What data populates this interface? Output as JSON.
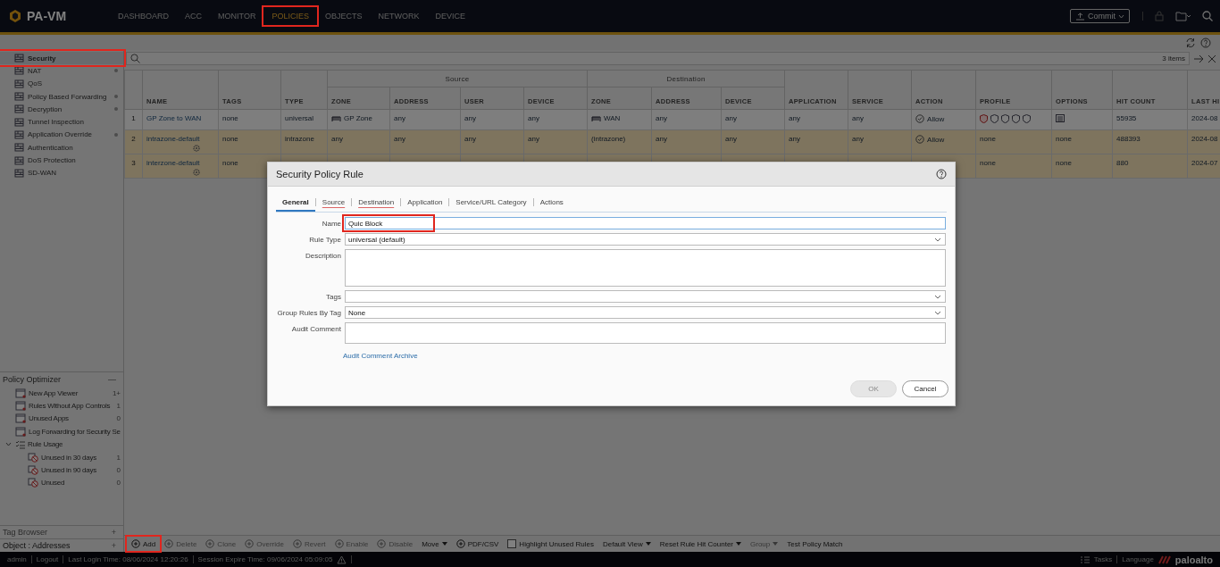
{
  "header": {
    "logo": "PA-VM",
    "nav": [
      {
        "label": "DASHBOARD",
        "selected": false,
        "highlighted": false
      },
      {
        "label": "ACC",
        "selected": false,
        "highlighted": false
      },
      {
        "label": "MONITOR",
        "selected": false,
        "highlighted": false
      },
      {
        "label": "POLICIES",
        "selected": true,
        "highlighted": true
      },
      {
        "label": "OBJECTS",
        "selected": false,
        "highlighted": false
      },
      {
        "label": "NETWORK",
        "selected": false,
        "highlighted": false
      },
      {
        "label": "DEVICE",
        "selected": false,
        "highlighted": false
      }
    ],
    "commit": "Commit"
  },
  "sidebar": {
    "items": [
      {
        "label": "Security",
        "selected": true,
        "highlighted": true,
        "dot": false
      },
      {
        "label": "NAT",
        "selected": false,
        "highlighted": false,
        "dot": true
      },
      {
        "label": "QoS",
        "selected": false,
        "highlighted": false,
        "dot": false
      },
      {
        "label": "Policy Based Forwarding",
        "selected": false,
        "highlighted": false,
        "dot": true
      },
      {
        "label": "Decryption",
        "selected": false,
        "highlighted": false,
        "dot": true
      },
      {
        "label": "Tunnel Inspection",
        "selected": false,
        "highlighted": false,
        "dot": false
      },
      {
        "label": "Application Override",
        "selected": false,
        "highlighted": false,
        "dot": true
      },
      {
        "label": "Authentication",
        "selected": false,
        "highlighted": false,
        "dot": false
      },
      {
        "label": "DoS Protection",
        "selected": false,
        "highlighted": false,
        "dot": false
      },
      {
        "label": "SD-WAN",
        "selected": false,
        "highlighted": false,
        "dot": false
      }
    ]
  },
  "policy_optimizer": {
    "title": "Policy Optimizer",
    "toggle": "—",
    "items": [
      {
        "label": "New App Viewer",
        "count": "1+"
      },
      {
        "label": "Rules Without App Controls",
        "count": "1"
      },
      {
        "label": "Unused Apps",
        "count": "0"
      },
      {
        "label": "Log Forwarding for Security Se"
      },
      {
        "label": "Rule Usage",
        "expanded": true,
        "children": [
          {
            "label": "Unused in 30 days",
            "count": "1"
          },
          {
            "label": "Unused in 90 days",
            "count": "0"
          },
          {
            "label": "Unused",
            "count": "0"
          }
        ]
      }
    ]
  },
  "tag_browser": {
    "title": "Tag Browser",
    "toggle": "+"
  },
  "object_browser": {
    "title": "Object : Addresses",
    "toggle": "+"
  },
  "search": {
    "count": "3 items"
  },
  "table": {
    "column_groups": [
      {
        "label": "Source"
      },
      {
        "label": "Destination"
      }
    ],
    "columns": [
      {
        "kind": "index"
      },
      {
        "kind": "single",
        "label": "NAME"
      },
      {
        "kind": "single",
        "label": "TAGS"
      },
      {
        "kind": "single",
        "label": "TYPE"
      },
      {
        "kind": "group-start",
        "label": "ZONE"
      },
      {
        "kind": "grouped",
        "label": "ADDRESS"
      },
      {
        "kind": "grouped",
        "label": "USER"
      },
      {
        "kind": "grouped",
        "label": "DEVICE"
      },
      {
        "kind": "group-start",
        "label": "ZONE"
      },
      {
        "kind": "grouped",
        "label": "ADDRESS"
      },
      {
        "kind": "grouped",
        "label": "DEVICE"
      },
      {
        "kind": "single",
        "label": "APPLICATION"
      },
      {
        "kind": "single",
        "label": "SERVICE"
      },
      {
        "kind": "single",
        "label": "ACTION"
      },
      {
        "kind": "single",
        "label": "PROFILE"
      },
      {
        "kind": "single",
        "label": "OPTIONS"
      },
      {
        "kind": "single",
        "label": "HIT COUNT"
      },
      {
        "kind": "single",
        "label": "LAST HI"
      }
    ],
    "rows": [
      {
        "predefined": false,
        "cells": [
          {
            "kind": "text",
            "text": "1"
          },
          {
            "kind": "rule",
            "text": "GP Zone to WAN"
          },
          {
            "kind": "text",
            "text": "none"
          },
          {
            "kind": "text",
            "text": "universal"
          },
          {
            "kind": "zone",
            "text": "GP Zone"
          },
          {
            "kind": "text",
            "text": "any"
          },
          {
            "kind": "text",
            "text": "any"
          },
          {
            "kind": "text",
            "text": "any"
          },
          {
            "kind": "zone",
            "text": "WAN"
          },
          {
            "kind": "text",
            "text": "any"
          },
          {
            "kind": "text",
            "text": "any"
          },
          {
            "kind": "text",
            "text": "any"
          },
          {
            "kind": "text",
            "text": "any"
          },
          {
            "kind": "action",
            "text": "Allow"
          },
          {
            "kind": "profiles"
          },
          {
            "kind": "options"
          },
          {
            "kind": "text",
            "text": "55935"
          },
          {
            "kind": "text",
            "text": "2024-08"
          }
        ]
      },
      {
        "predefined": true,
        "cells": [
          {
            "kind": "text",
            "text": "2"
          },
          {
            "kind": "default-rule",
            "text": "intrazone-default"
          },
          {
            "kind": "text",
            "text": "none"
          },
          {
            "kind": "text",
            "text": "intrazone"
          },
          {
            "kind": "text",
            "text": "any"
          },
          {
            "kind": "text",
            "text": "any"
          },
          {
            "kind": "text",
            "text": "any"
          },
          {
            "kind": "text",
            "text": "any"
          },
          {
            "kind": "text",
            "text": "(intrazone)"
          },
          {
            "kind": "text",
            "text": "any"
          },
          {
            "kind": "text",
            "text": "any"
          },
          {
            "kind": "text",
            "text": "any"
          },
          {
            "kind": "text",
            "text": "any"
          },
          {
            "kind": "action",
            "text": "Allow"
          },
          {
            "kind": "text",
            "text": "none"
          },
          {
            "kind": "text",
            "text": "none"
          },
          {
            "kind": "text",
            "text": "488393"
          },
          {
            "kind": "text",
            "text": "2024-08"
          }
        ]
      },
      {
        "predefined": true,
        "cells": [
          {
            "kind": "text",
            "text": "3"
          },
          {
            "kind": "default-rule",
            "text": "interzone-default"
          },
          {
            "kind": "text",
            "text": "none"
          },
          null,
          null,
          null,
          null,
          null,
          null,
          null,
          null,
          null,
          null,
          null,
          {
            "kind": "text",
            "text": "none"
          },
          {
            "kind": "text",
            "text": "none"
          },
          {
            "kind": "text",
            "text": "880"
          },
          {
            "kind": "text",
            "text": "2024-07"
          }
        ]
      }
    ]
  },
  "toolbar": [
    {
      "kind": "button",
      "label": "Add",
      "disabled": false,
      "highlighted": true
    },
    {
      "kind": "button",
      "label": "Delete",
      "disabled": true,
      "highlighted": false
    },
    {
      "kind": "button",
      "label": "Clone",
      "disabled": true,
      "highlighted": false
    },
    {
      "kind": "button",
      "label": "Override",
      "disabled": true,
      "highlighted": false
    },
    {
      "kind": "button",
      "label": "Revert",
      "disabled": true,
      "highlighted": false
    },
    {
      "kind": "button",
      "label": "Enable",
      "disabled": true,
      "highlighted": false
    },
    {
      "kind": "button",
      "label": "Disable",
      "disabled": true,
      "highlighted": false
    },
    {
      "kind": "menu",
      "label": "Move",
      "disabled": false,
      "highlighted": false
    },
    {
      "kind": "button",
      "label": "PDF/CSV",
      "disabled": false,
      "highlighted": false
    },
    {
      "kind": "checkbox",
      "label": "Highlight Unused Rules",
      "checked": false,
      "highlighted": false
    },
    {
      "kind": "menu",
      "label": "Default View",
      "disabled": false,
      "highlighted": false
    },
    {
      "kind": "menu",
      "label": "Reset Rule Hit Counter",
      "disabled": false,
      "highlighted": false
    },
    {
      "kind": "menu",
      "label": "Group",
      "disabled": true,
      "highlighted": false
    },
    {
      "kind": "plain",
      "label": "Test Policy Match",
      "disabled": false,
      "highlighted": false
    }
  ],
  "footer": {
    "left": [
      "admin",
      "Logout",
      "Last Login Time: 08/06/2024 12:20:26",
      "Session Expire Time: 09/06/2024 05:09:05"
    ],
    "right": [
      "Tasks",
      "Language"
    ],
    "brand": "paloalto"
  },
  "dialog": {
    "title": "Security Policy Rule",
    "tabs": [
      {
        "label": "General",
        "selected": true,
        "error": false
      },
      {
        "label": "Source",
        "selected": false,
        "error": true
      },
      {
        "label": "Destination",
        "selected": false,
        "error": true
      },
      {
        "label": "Application",
        "selected": false,
        "error": false
      },
      {
        "label": "Service/URL Category",
        "selected": false,
        "error": false
      },
      {
        "label": "Actions",
        "selected": false,
        "error": false
      }
    ],
    "fields": [
      {
        "kind": "text",
        "label": "Name",
        "value": "Quic Block",
        "focused": true,
        "highlighted": true
      },
      {
        "kind": "select",
        "label": "Rule Type",
        "value": "universal (default)"
      },
      {
        "kind": "textarea",
        "label": "Description"
      },
      {
        "kind": "select",
        "label": "Tags"
      },
      {
        "kind": "select",
        "label": "Group Rules By Tag",
        "value": "None"
      },
      {
        "kind": "textarea",
        "label": "Audit Comment"
      }
    ],
    "link": "Audit Comment Archive",
    "buttons": [
      {
        "label": "OK",
        "disabled": true
      },
      {
        "label": "Cancel",
        "disabled": false
      }
    ]
  }
}
